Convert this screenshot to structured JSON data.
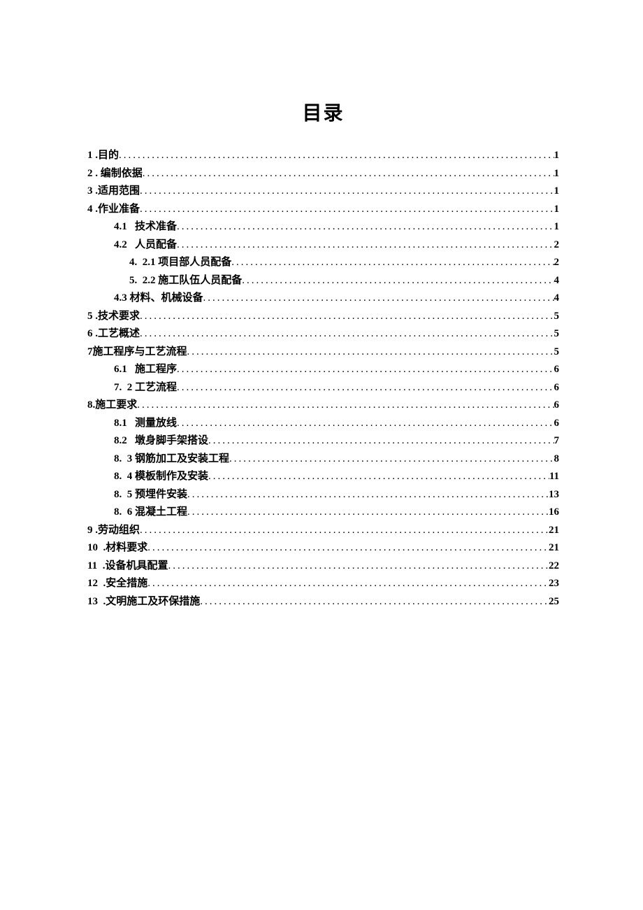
{
  "title": "目录",
  "entries": [
    {
      "indent": 0,
      "num": "1",
      "sep": " .",
      "text": "目的",
      "page": "1",
      "numGap": "sm"
    },
    {
      "indent": 0,
      "num": "2",
      "sep": " . ",
      "text": "编制依据",
      "page": "1",
      "numGap": "sm"
    },
    {
      "indent": 0,
      "num": "3",
      "sep": " .",
      "text": "适用范围",
      "page": "1",
      "numGap": "sm"
    },
    {
      "indent": 0,
      "num": "4",
      "sep": " .",
      "text": "作业准备",
      "page": "1",
      "numGap": "sm"
    },
    {
      "indent": 1,
      "num": "4.1",
      "sep": "   ",
      "text": "技术准备",
      "page": "1",
      "numGap": ""
    },
    {
      "indent": 1,
      "num": "4.2",
      "sep": "   ",
      "text": "人员配备",
      "page": "2",
      "numGap": ""
    },
    {
      "indent": 2,
      "num": "4.",
      "sep": "  ",
      "text": "2.1 项目部人员配备",
      "page": "2",
      "numGap": ""
    },
    {
      "indent": 2,
      "num": "5.",
      "sep": "  ",
      "text": "2.2 施工队伍人员配备",
      "page": "4",
      "numGap": ""
    },
    {
      "indent": 1,
      "num": "4.3",
      "sep": " ",
      "text": "材料、机械设备 ",
      "page": "4",
      "numGap": ""
    },
    {
      "indent": 0,
      "num": "5",
      "sep": " .",
      "text": "技术要求",
      "page": "5",
      "numGap": "sm"
    },
    {
      "indent": 0,
      "num": "6",
      "sep": " .",
      "text": "工艺概述",
      "page": "5",
      "numGap": "sm"
    },
    {
      "indent": 0,
      "num": "7 ",
      "sep": "",
      "text": "施工程序与工艺流程 ",
      "page": "5",
      "numGap": ""
    },
    {
      "indent": 1,
      "num": "6.1",
      "sep": "   ",
      "text": "施工程序",
      "page": "6",
      "numGap": ""
    },
    {
      "indent": 1,
      "num": "7.",
      "sep": "  ",
      "text": "2 工艺流程",
      "page": "6",
      "numGap": ""
    },
    {
      "indent": 0,
      "num": "8.",
      "sep": "",
      "text": "施工要求 ",
      "page": "6",
      "numGap": ""
    },
    {
      "indent": 1,
      "num": "8.1",
      "sep": "   ",
      "text": "测量放线",
      "page": "6",
      "numGap": ""
    },
    {
      "indent": 1,
      "num": "8.2",
      "sep": "   ",
      "text": "墩身脚手架搭设",
      "page": "7",
      "numGap": ""
    },
    {
      "indent": 1,
      "num": "8.",
      "sep": "  ",
      "text": "3 钢筋加工及安装工程",
      "page": "8",
      "numGap": ""
    },
    {
      "indent": 1,
      "num": "8.",
      "sep": "  ",
      "text": "4 模板制作及安装 ",
      "page": "11",
      "numGap": ""
    },
    {
      "indent": 1,
      "num": "8.",
      "sep": "  ",
      "text": "5 预埋件安装 ",
      "page": "13",
      "numGap": ""
    },
    {
      "indent": 1,
      "num": "8.",
      "sep": "  ",
      "text": "6 混凝土工程",
      "page": "16",
      "numGap": ""
    },
    {
      "indent": 0,
      "num": "9",
      "sep": " .",
      "text": "劳动组织",
      "page": "21",
      "numGap": "sm"
    },
    {
      "indent": 0,
      "num": "10",
      "sep": "  .",
      "text": "材料要求",
      "page": "21",
      "numGap": ""
    },
    {
      "indent": 0,
      "num": "11",
      "sep": "  .",
      "text": "设备机具配置",
      "page": "22",
      "numGap": ""
    },
    {
      "indent": 0,
      "num": "12",
      "sep": "  .",
      "text": "安全措施",
      "page": "23",
      "numGap": ""
    },
    {
      "indent": 0,
      "num": "13",
      "sep": "  .",
      "text": "文明施工及环保措施",
      "page": "25",
      "numGap": ""
    }
  ]
}
